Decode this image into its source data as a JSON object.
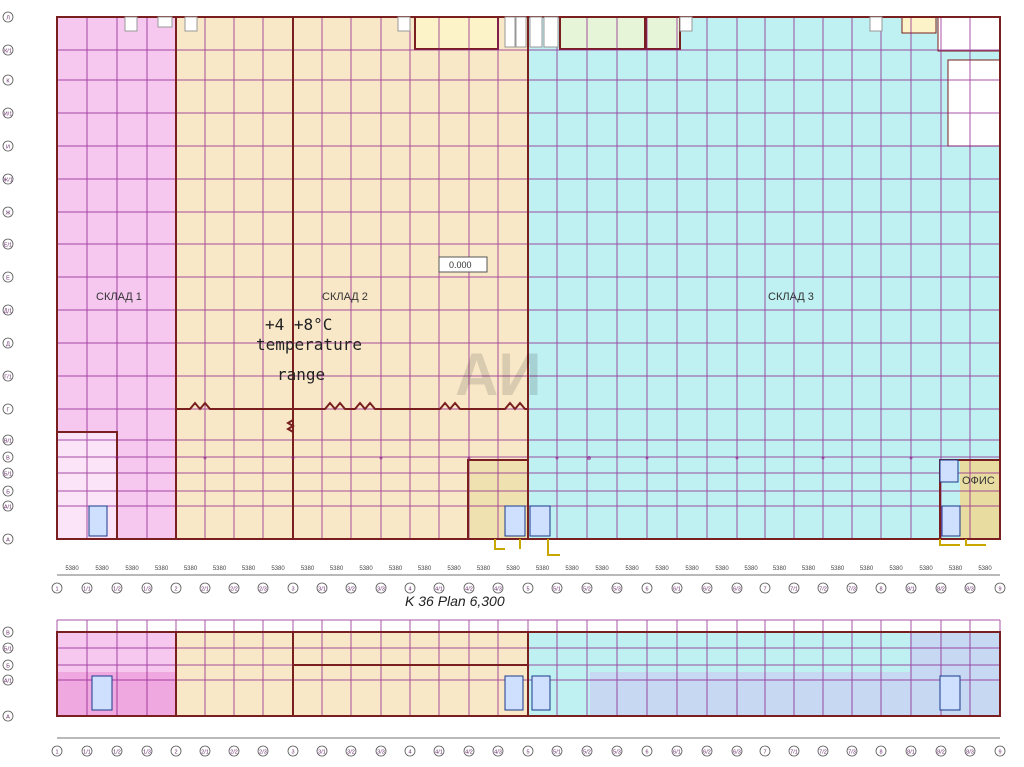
{
  "colors": {
    "grid": "#8b1a8b",
    "wall": "#7a1f1f",
    "warehouse1": "#f6c8f0",
    "warehouse2": "#f9e8c8",
    "warehouse3": "#bff0f2",
    "office": "#e8dca0",
    "lower_blue": "#c6d8f2"
  },
  "rooms": {
    "warehouse1": "СКЛАД 1",
    "warehouse2": "СКЛАД 2",
    "warehouse3": "СКЛАД 3",
    "office": "ОФИС",
    "elevation": "0.000"
  },
  "temperature": {
    "line1": "+4 +8°C",
    "line2": "temperature",
    "line3": "range"
  },
  "plan_title": "K 36  Plan  6,300",
  "watermark": "АИ",
  "dim_5380": "5380",
  "top_axis_labels": [
    "1",
    "1/1",
    "1/2",
    "1/3",
    "2",
    "2/1",
    "2/2",
    "2/3",
    "3",
    "3/1",
    "3/2",
    "3/3",
    "4",
    "4/1",
    "4/2",
    "4/3",
    "5",
    "5/1",
    "5/2",
    "5/3",
    "6",
    "6/1",
    "6/2",
    "6/3",
    "7",
    "7/1",
    "7/2",
    "7/3",
    "8",
    "8/1",
    "8/2",
    "8/3",
    "9",
    "9/1",
    "9/2",
    "10"
  ],
  "left_axis_labels": [
    "Л",
    "К/1",
    "К",
    "И/1",
    "И",
    "Ж/1",
    "Ж",
    "Е/1",
    "Е",
    "Д/1",
    "Д",
    "Г/1",
    "Г",
    "В/1",
    "В",
    "Б/1",
    "Б",
    "А/1",
    "А"
  ],
  "lower_left_labels": [
    "В",
    "Б/1",
    "Б",
    "А/1",
    "А"
  ],
  "icons": {
    "stair": "stair-icon",
    "column": "column-icon"
  }
}
